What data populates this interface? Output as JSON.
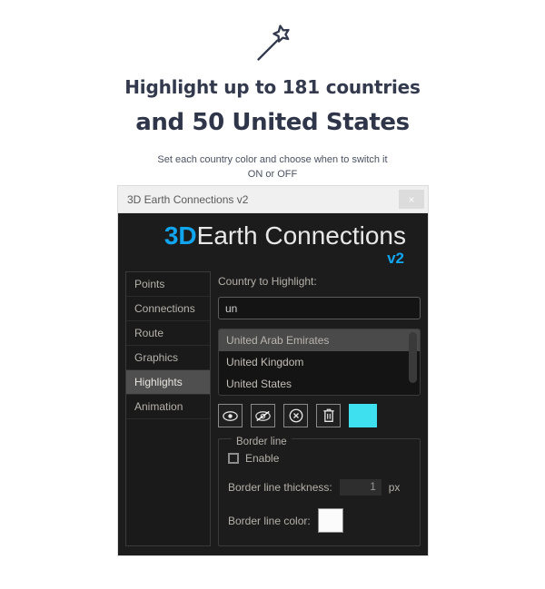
{
  "promo": {
    "icon": "magic-wand-icon",
    "headline": "Highlight up to 181 countries",
    "subheadline": "and 50 United States",
    "description": "Set each country color and choose when to switch it ON or OFF"
  },
  "window": {
    "title": "3D Earth Connections v2",
    "close_label": "×"
  },
  "logo": {
    "accent": "3D",
    "name": "Earth Connections",
    "version": "v2",
    "accent_color": "#12a5ef"
  },
  "sidebar": {
    "items": [
      {
        "label": "Points",
        "selected": false
      },
      {
        "label": "Connections",
        "selected": false
      },
      {
        "label": "Route",
        "selected": false
      },
      {
        "label": "Graphics",
        "selected": false
      },
      {
        "label": "Highlights",
        "selected": true
      },
      {
        "label": "Animation",
        "selected": false
      }
    ]
  },
  "main": {
    "country_label": "Country to Highlight:",
    "search_value": "un",
    "search_placeholder": "",
    "country_list": [
      {
        "label": "United Arab Emirates",
        "selected": true
      },
      {
        "label": "United Kingdom",
        "selected": false
      },
      {
        "label": "United States",
        "selected": false
      }
    ],
    "actions": [
      {
        "name": "show-highlight-button",
        "icon": "eye-icon"
      },
      {
        "name": "hide-highlight-button",
        "icon": "eye-slash-icon"
      },
      {
        "name": "clear-highlight-button",
        "icon": "circle-x-icon"
      },
      {
        "name": "delete-highlight-button",
        "icon": "trash-icon"
      }
    ],
    "highlight_color": "#3ee0f0",
    "border_group": {
      "legend": "Border line",
      "enable_label": "Enable",
      "enable_checked": false,
      "thickness_label": "Border line thickness:",
      "thickness_value": "1",
      "thickness_unit": "px",
      "color_label": "Border line color:",
      "color_value": "#ffffff"
    }
  }
}
